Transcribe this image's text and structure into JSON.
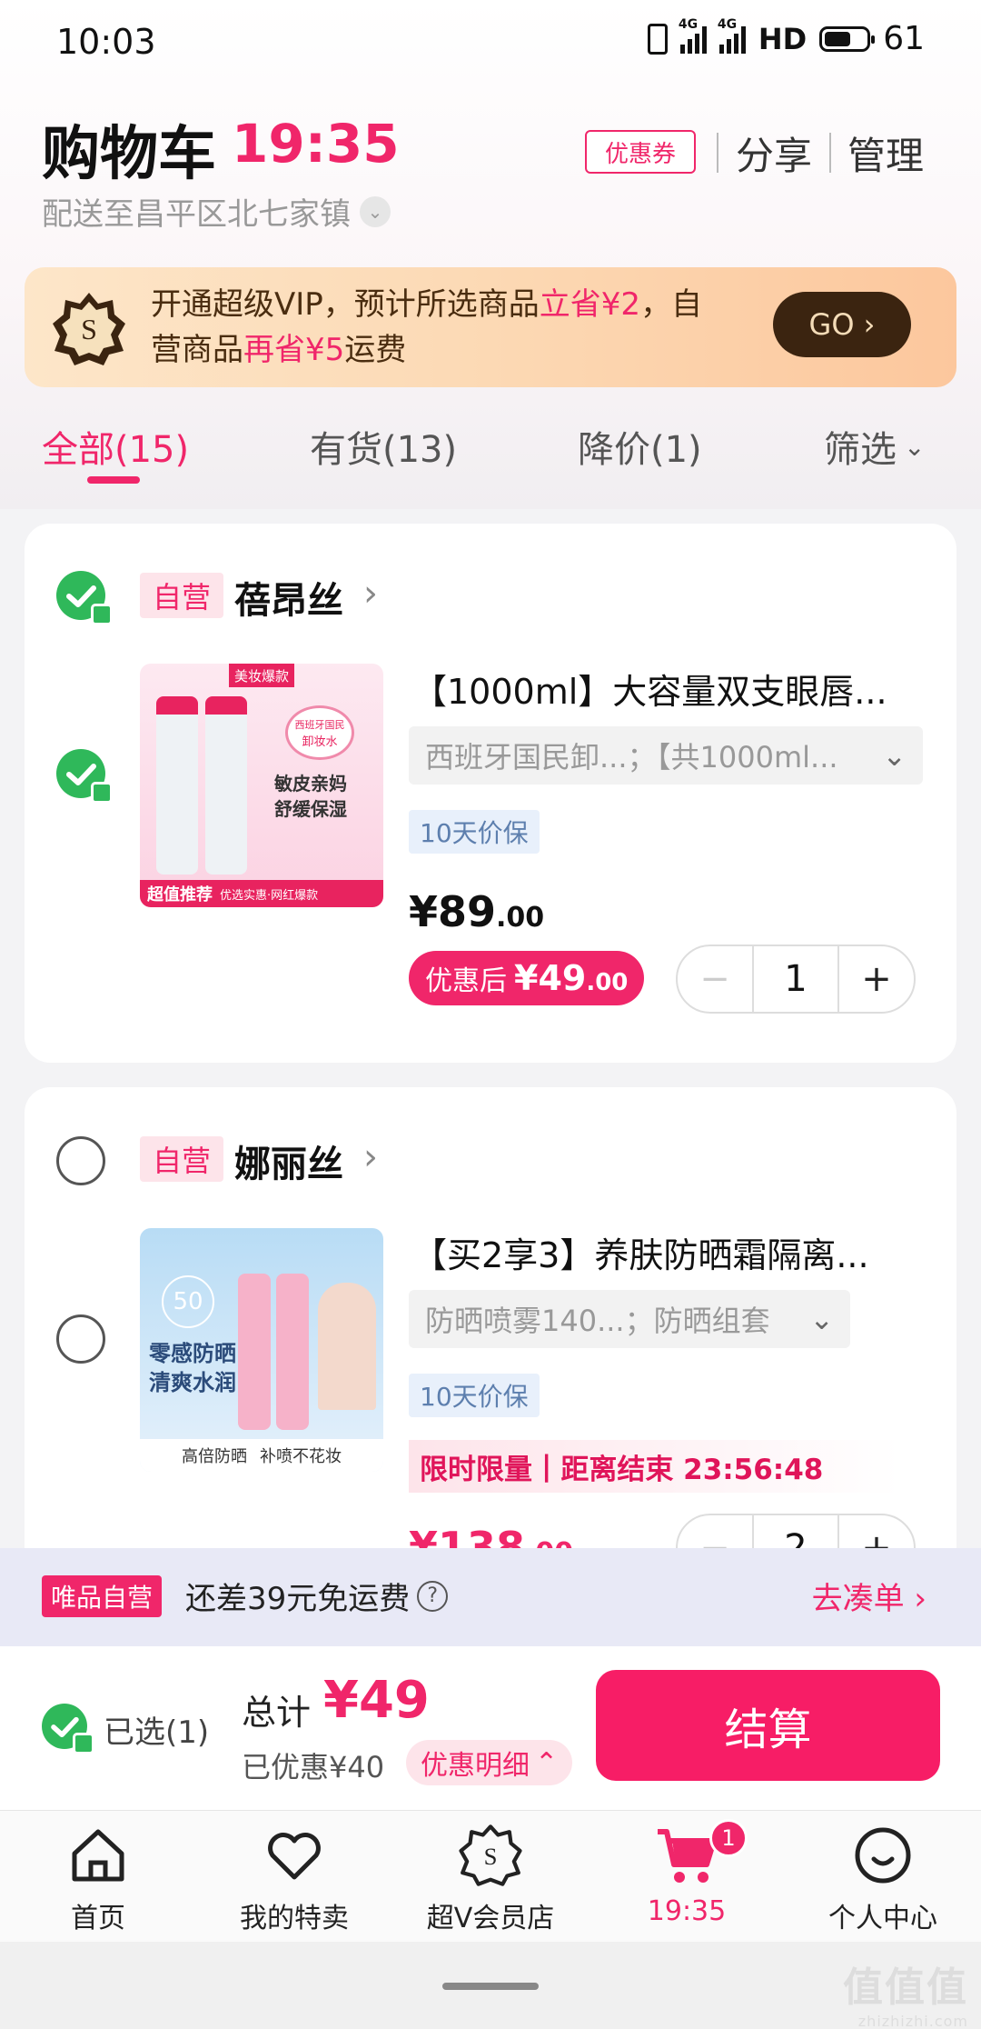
{
  "status_bar": {
    "time": "10:03",
    "net1": "4G",
    "net2": "4G",
    "hd": "HD",
    "battery": "61"
  },
  "header": {
    "title": "购物车",
    "timer": "19:35",
    "coupon": "优惠券",
    "share": "分享",
    "manage": "管理",
    "address": "配送至昌平区北七家镇"
  },
  "vip_banner": {
    "text_a": "开通超级VIP，预计所选商品",
    "text_b": "立省¥2",
    "text_c": "，自营商品",
    "text_d": "再省¥5",
    "text_e": "运费",
    "go": "GO ›"
  },
  "tabs": [
    {
      "label": "全部(15)"
    },
    {
      "label": "有货(13)"
    },
    {
      "label": "降价(1)"
    },
    {
      "label": "筛选"
    }
  ],
  "items": [
    {
      "tag": "自营",
      "shop": "蓓昂丝",
      "title": "【1000ml】大容量双支眼唇...",
      "spec": "西班牙国民卸...；【共1000ml...",
      "guarantee": "10天价保",
      "price_int": "¥89",
      "price_dec": ".00",
      "after_label": "优惠后",
      "after_int": "¥49",
      "after_dec": ".00",
      "qty": "1",
      "img": {
        "top": "美妆爆款",
        "badge1": "西班牙国民",
        "badge2": "卸妆水",
        "copy1": "敏皮亲妈",
        "copy2": "舒缓保湿",
        "bottom_a": "超值推荐",
        "bottom_b": "优选实惠·网红爆款"
      }
    },
    {
      "tag": "自营",
      "shop": "娜丽丝",
      "title": "【买2享3】养肤防晒霜隔离...",
      "spec": "防晒喷雾140...；防晒组套",
      "guarantee": "10天价保",
      "limited_a": "限时限量",
      "limited_b": "距离结束 23:56:48",
      "price_int": "¥138",
      "price_dec": ".00",
      "qty": "2",
      "img": {
        "spf": "50",
        "copy1": "零感防晒",
        "copy2": "清爽水润",
        "bottom_a": "高倍防晒",
        "bottom_b": "补喷不花妆"
      }
    }
  ],
  "shipping": {
    "tag": "唯品自营",
    "text": "还差39元免运费",
    "help": "?",
    "link": "去凑单 ›"
  },
  "checkout": {
    "selected": "已选(1)",
    "total_label": "总计",
    "total_value": "¥49",
    "discount": "已优惠¥40",
    "discount_detail": "优惠明细",
    "pay": "结算"
  },
  "nav": [
    {
      "label": "首页",
      "icon": "home-icon"
    },
    {
      "label": "我的特卖",
      "icon": "heart-icon"
    },
    {
      "label": "超V会员店",
      "icon": "vip-badge-icon"
    },
    {
      "label": "19:35",
      "icon": "cart-icon",
      "badge": "1"
    },
    {
      "label": "个人中心",
      "icon": "smile-icon"
    }
  ],
  "watermark": {
    "main": "值值值",
    "sub": "zhizhizhi.com"
  },
  "colors": {
    "accent": "#f0266a",
    "check": "#2fb85a",
    "vip_dark": "#3b2410"
  }
}
